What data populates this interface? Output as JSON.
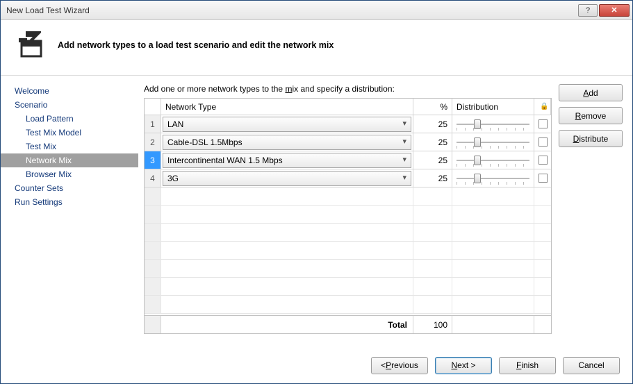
{
  "window": {
    "title": "New Load Test Wizard"
  },
  "header": {
    "headline": "Add network types to a load test scenario and edit the network mix"
  },
  "sidebar": {
    "items": [
      {
        "label": "Welcome",
        "level": 0,
        "selected": false
      },
      {
        "label": "Scenario",
        "level": 0,
        "selected": false
      },
      {
        "label": "Load Pattern",
        "level": 1,
        "selected": false
      },
      {
        "label": "Test Mix Model",
        "level": 1,
        "selected": false
      },
      {
        "label": "Test Mix",
        "level": 1,
        "selected": false
      },
      {
        "label": "Network Mix",
        "level": 1,
        "selected": true
      },
      {
        "label": "Browser Mix",
        "level": 1,
        "selected": false
      },
      {
        "label": "Counter Sets",
        "level": 0,
        "selected": false
      },
      {
        "label": "Run Settings",
        "level": 0,
        "selected": false
      }
    ]
  },
  "instruction_prefix": "Add one or more network types to the ",
  "instruction_accel": "m",
  "instruction_suffix": "ix and specify a distribution:",
  "grid": {
    "columns": {
      "rownum": "",
      "nettype": "Network Type",
      "pct": "%",
      "dist": "Distribution",
      "lock": "🔒"
    },
    "rows": [
      {
        "n": "1",
        "type": "LAN",
        "pct": "25",
        "slider": 25,
        "selected": false
      },
      {
        "n": "2",
        "type": "Cable-DSL 1.5Mbps",
        "pct": "25",
        "slider": 25,
        "selected": false
      },
      {
        "n": "3",
        "type": "Intercontinental WAN 1.5 Mbps",
        "pct": "25",
        "slider": 25,
        "selected": true
      },
      {
        "n": "4",
        "type": "3G",
        "pct": "25",
        "slider": 25,
        "selected": false
      }
    ],
    "empty_rows": 7,
    "footer": {
      "label": "Total",
      "value": "100"
    }
  },
  "side_buttons": {
    "add": "Add",
    "remove": "Remove",
    "distribute": "Distribute"
  },
  "wizard_buttons": {
    "previous_pre": "< ",
    "previous_accel": "P",
    "previous_post": "revious",
    "next_accel": "N",
    "next_post": "ext >",
    "finish_accel": "F",
    "finish_post": "inish",
    "cancel": "Cancel"
  }
}
